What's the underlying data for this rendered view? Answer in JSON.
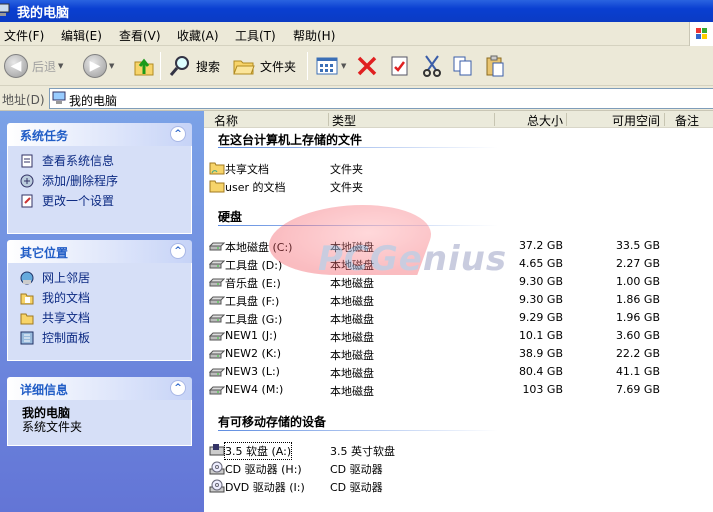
{
  "window": {
    "title": "我的电脑"
  },
  "menu": [
    "文件(F)",
    "编辑(E)",
    "查看(V)",
    "收藏(A)",
    "工具(T)",
    "帮助(H)"
  ],
  "toolbar": {
    "back": "后退",
    "search": "搜索",
    "folders": "文件夹"
  },
  "address": {
    "label": "地址(D)",
    "value": "我的电脑"
  },
  "tasks": {
    "system": {
      "title": "系统任务",
      "items": [
        "查看系统信息",
        "添加/删除程序",
        "更改一个设置"
      ]
    },
    "other": {
      "title": "其它位置",
      "items": [
        "网上邻居",
        "我的文档",
        "共享文档",
        "控制面板"
      ]
    },
    "details": {
      "title": "详细信息",
      "name": "我的电脑",
      "desc": "系统文件夹"
    }
  },
  "columns": [
    "名称",
    "类型",
    "总大小",
    "可用空间",
    "备注"
  ],
  "groups": {
    "stored": {
      "title": "在这台计算机上存储的文件",
      "items": [
        {
          "name": "共享文档",
          "type": "文件夹"
        },
        {
          "name": "user 的文档",
          "type": "文件夹"
        }
      ]
    },
    "disks": {
      "title": "硬盘",
      "items": [
        {
          "name": "本地磁盘 (C:)",
          "type": "本地磁盘",
          "size": "37.2 GB",
          "free": "33.5 GB"
        },
        {
          "name": "工具盘 (D:)",
          "type": "本地磁盘",
          "size": "4.65 GB",
          "free": "2.27 GB"
        },
        {
          "name": "音乐盘 (E:)",
          "type": "本地磁盘",
          "size": "9.30 GB",
          "free": "1.00 GB"
        },
        {
          "name": "工具盘 (F:)",
          "type": "本地磁盘",
          "size": "9.30 GB",
          "free": "1.86 GB"
        },
        {
          "name": "工具盘 (G:)",
          "type": "本地磁盘",
          "size": "9.29 GB",
          "free": "1.96 GB"
        },
        {
          "name": "NEW1 (J:)",
          "type": "本地磁盘",
          "size": "10.1 GB",
          "free": "3.60 GB"
        },
        {
          "name": "NEW2 (K:)",
          "type": "本地磁盘",
          "size": "38.9 GB",
          "free": "22.2 GB"
        },
        {
          "name": "NEW3 (L:)",
          "type": "本地磁盘",
          "size": "80.4 GB",
          "free": "41.1 GB"
        },
        {
          "name": "NEW4 (M:)",
          "type": "本地磁盘",
          "size": "103 GB",
          "free": "7.69 GB"
        }
      ]
    },
    "removable": {
      "title": "有可移动存储的设备",
      "items": [
        {
          "name": "3.5 软盘 (A:)",
          "type": "3.5 英寸软盘"
        },
        {
          "name": "CD 驱动器 (H:)",
          "type": "CD 驱动器"
        },
        {
          "name": "DVD 驱动器 (I:)",
          "type": "CD 驱动器"
        }
      ]
    }
  },
  "watermark": "PCGenius",
  "colors": {
    "titlebar": "#0a3fd1",
    "taskpane": "#6f8fe0",
    "panelHeaderText": "#215dc6"
  }
}
